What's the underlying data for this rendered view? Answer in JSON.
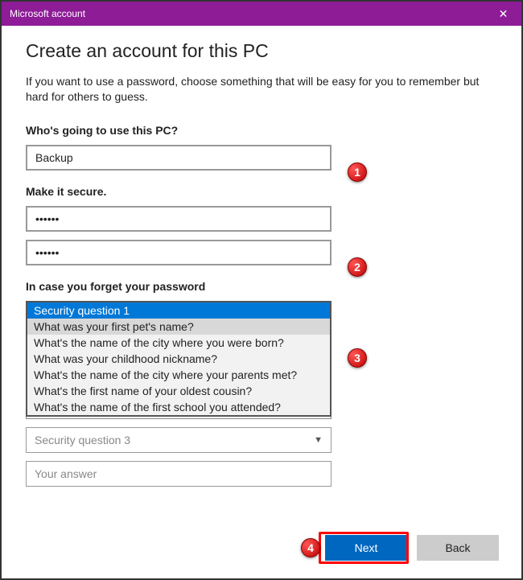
{
  "titlebar": {
    "title": "Microsoft account",
    "close_label": "✕"
  },
  "page": {
    "title": "Create an account for this PC",
    "subtitle": "If you want to use a password, choose something that will be easy for you to remember but hard for others to guess."
  },
  "section_user": {
    "label": "Who's going to use this PC?",
    "value": "Backup"
  },
  "section_password": {
    "label": "Make it secure.",
    "value1": "••••••",
    "value2": "••••••"
  },
  "section_forgot": {
    "label": "In case you forget your password",
    "dropdown1": {
      "options": [
        "Security question 1",
        "What was your first pet's name?",
        "What's the name of the city where you were born?",
        "What was your childhood nickname?",
        "What's the name of the city where your parents met?",
        "What's the first name of your oldest cousin?",
        "What's the name of the first school you attended?"
      ]
    },
    "dropdown3_placeholder": "Security question 3",
    "answer_placeholder": "Your answer"
  },
  "footer": {
    "next": "Next",
    "back": "Back"
  },
  "callouts": {
    "c1": "1",
    "c2": "2",
    "c3": "3",
    "c4": "4"
  }
}
